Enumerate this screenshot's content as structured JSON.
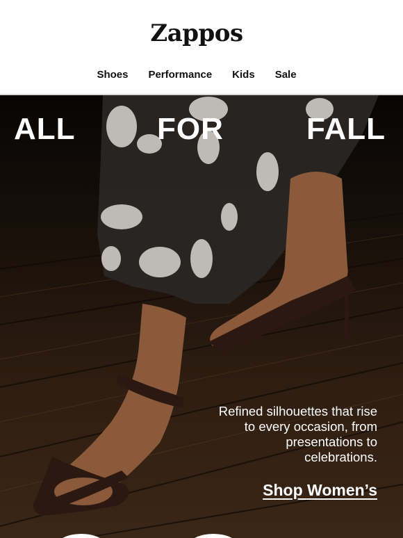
{
  "brand": {
    "logo": "Zappos"
  },
  "nav": {
    "items": [
      "Shoes",
      "Performance",
      "Kids",
      "Sale"
    ]
  },
  "hero": {
    "headline": [
      "ALL",
      "FOR",
      "FALL"
    ],
    "copy": "Refined silhouettes that rise to every occasion, from presentations to celebrations.",
    "cta": "Shop Women’s"
  },
  "colors": {
    "text": "#111111",
    "hero_text": "#ffffff",
    "divider": "#d9d9d9"
  }
}
